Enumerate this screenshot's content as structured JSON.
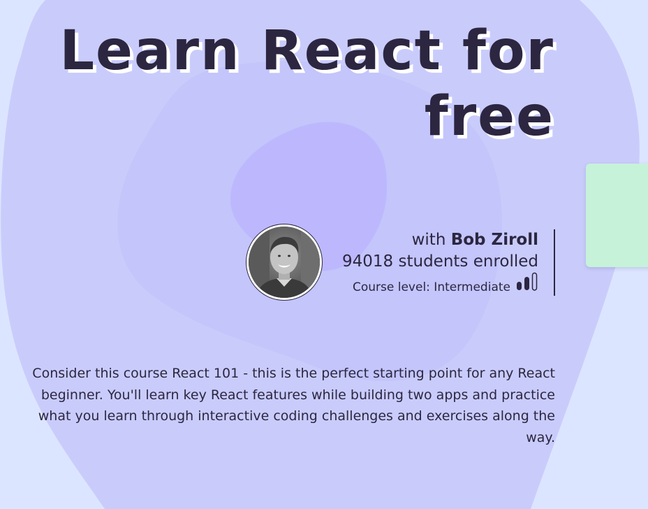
{
  "course": {
    "title": "Learn React for free",
    "with_prefix": "with",
    "instructor_name": "Bob Ziroll",
    "students_enrolled": "94018 students enrolled",
    "course_level_label": "Course level: Intermediate",
    "level_icon": "level-bars-icon",
    "description": "Consider this course React 101 - this is the perfect starting point for any React beginner. You'll learn key React features while building two apps and practice what you learn through interactive coding challenges and exercises along the way."
  },
  "avatar": {
    "icon": "instructor-avatar-photo"
  },
  "colors": {
    "background": "#dce5ff",
    "blob_outer": "#c9ccfb",
    "blob_middle": "#c4c4fb",
    "blob_inner": "#bfb9fd",
    "text": "#2c2641",
    "side_card": "#c6f2d9"
  }
}
